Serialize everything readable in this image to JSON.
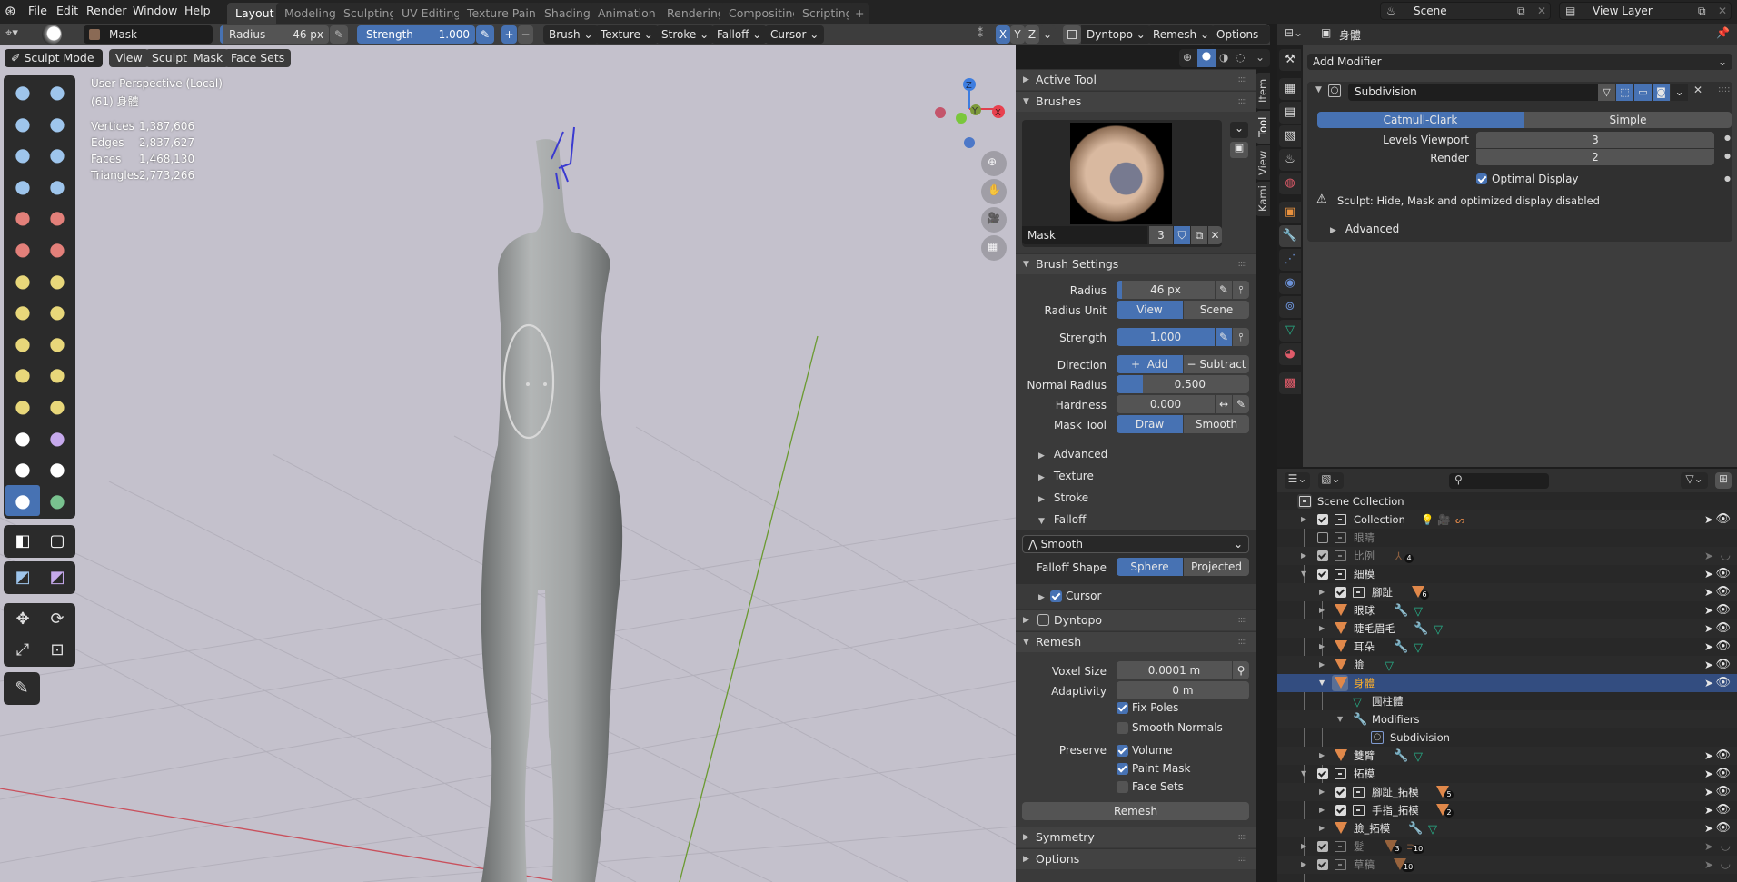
{
  "menu": {
    "items": [
      "File",
      "Edit",
      "Render",
      "Window",
      "Help"
    ],
    "workspaces": [
      "Layout",
      "Modeling",
      "Sculpting",
      "UV Editing",
      "Texture Paint",
      "Shading",
      "Animation",
      "Rendering",
      "Compositing",
      "Scripting"
    ],
    "active_workspace": "Layout",
    "add_tab": "+",
    "scene": "Scene",
    "view_layer": "View Layer"
  },
  "tool_header": {
    "brush_name": "Mask",
    "radius_label": "Radius",
    "radius_value": "46 px",
    "strength_label": "Strength",
    "strength_value": "1.000",
    "plus": "+",
    "minus": "−",
    "menus": [
      "Brush",
      "Texture",
      "Stroke",
      "Falloff",
      "Cursor"
    ],
    "axes": [
      "X",
      "Y",
      "Z"
    ],
    "dyntopo": "Dyntopo",
    "remesh": "Remesh",
    "options": "Options"
  },
  "viewport": {
    "mode": "Sculpt Mode",
    "menus": [
      "View",
      "Sculpt",
      "Mask",
      "Face Sets"
    ],
    "perspective": "User Perspective (Local)",
    "object_label": "(61) 身體",
    "stats": [
      {
        "label": "Vertices",
        "value": "1,387,606"
      },
      {
        "label": "Edges",
        "value": "2,837,627"
      },
      {
        "label": "Faces",
        "value": "1,468,130"
      },
      {
        "label": "Triangles",
        "value": "2,773,266"
      }
    ],
    "gizmo_axes": [
      "X",
      "Y",
      "Z"
    ],
    "accent": "#4772b3"
  },
  "npanel": {
    "tabs": [
      "Item",
      "Tool",
      "View",
      "Kami"
    ],
    "active_tab": "Tool",
    "active_tool": "Active Tool",
    "brushes": "Brushes",
    "brush_name": "Mask",
    "brush_users": "3",
    "brush_settings": "Brush Settings",
    "radius_label": "Radius",
    "radius_value": "46 px",
    "radius_unit_label": "Radius Unit",
    "radius_unit_options": [
      "View",
      "Scene"
    ],
    "strength_label": "Strength",
    "strength_value": "1.000",
    "direction_label": "Direction",
    "direction_options": [
      "Add",
      "Subtract"
    ],
    "normal_radius_label": "Normal Radius",
    "normal_radius_value": "0.500",
    "normal_radius_fraction": 0.5,
    "hardness_label": "Hardness",
    "hardness_value": "0.000",
    "mask_tool_label": "Mask Tool",
    "mask_tool_options": [
      "Draw",
      "Smooth"
    ],
    "subpanels": [
      "Advanced",
      "Texture",
      "Stroke",
      "Falloff"
    ],
    "falloff_preset": "Smooth",
    "falloff_shape_label": "Falloff Shape",
    "falloff_shape_options": [
      "Sphere",
      "Projected"
    ],
    "cursor": "Cursor",
    "dyntopo": "Dyntopo",
    "remesh": "Remesh",
    "voxel_size_label": "Voxel Size",
    "voxel_size_value": "0.0001 m",
    "adaptivity_label": "Adaptivity",
    "adaptivity_value": "0 m",
    "fix_poles": "Fix Poles",
    "smooth_normals": "Smooth Normals",
    "preserve_label": "Preserve",
    "preserve_volume": "Volume",
    "preserve_paint_mask": "Paint Mask",
    "preserve_face_sets": "Face Sets",
    "remesh_button": "Remesh",
    "symmetry": "Symmetry",
    "options": "Options"
  },
  "properties": {
    "object_name": "身體",
    "add_modifier": "Add Modifier",
    "modifier_name": "Subdivision",
    "subdiv_types": [
      "Catmull-Clark",
      "Simple"
    ],
    "levels_viewport_label": "Levels Viewport",
    "levels_viewport": "3",
    "render_label": "Render",
    "render_levels": "2",
    "optimal_display": "Optimal Display",
    "warning": "Sculpt: Hide, Mask and optimized display disabled",
    "advanced": "Advanced"
  },
  "outliner": {
    "rows": [
      {
        "name": "Scene Collection"
      },
      {
        "name": "Collection"
      },
      {
        "name": "眼睛"
      },
      {
        "name": "比例",
        "badge": "4"
      },
      {
        "name": "細模"
      },
      {
        "name": "腳趾",
        "badge": "6"
      },
      {
        "name": "眼球"
      },
      {
        "name": "睫毛眉毛"
      },
      {
        "name": "耳朵"
      },
      {
        "name": "臉"
      },
      {
        "name": "身體"
      },
      {
        "name": "圓柱體"
      },
      {
        "name": "Modifiers"
      },
      {
        "name": "Subdivision"
      },
      {
        "name": "雙臂"
      },
      {
        "name": "拓模"
      },
      {
        "name": "腳趾_拓模",
        "badge": "5"
      },
      {
        "name": "手指_拓模",
        "badge": "2"
      },
      {
        "name": "臉_拓模"
      },
      {
        "name": "髮",
        "badge": "3",
        "badge2": "10"
      },
      {
        "name": "草稿",
        "badge": "10"
      }
    ]
  }
}
